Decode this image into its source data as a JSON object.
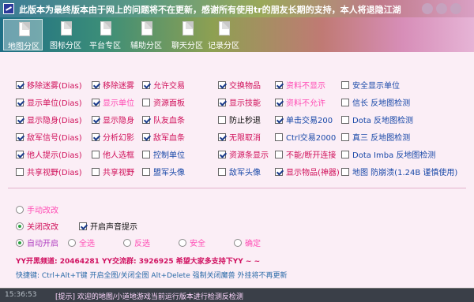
{
  "title": "此版本为最终版本由于网上的问题将不在更新，感谢所有使用tr的朋友长期的支持，本人将退隐江湖",
  "tabs": [
    {
      "label": "地图分区"
    },
    {
      "label": "图标分区"
    },
    {
      "label": "平台专区"
    },
    {
      "label": "辅助分区"
    },
    {
      "label": "聊天分区"
    },
    {
      "label": "记录分区"
    }
  ],
  "options": [
    {
      "label": "移除迷雾(Dias)",
      "checked": true
    },
    {
      "label": "移除迷雾",
      "checked": true
    },
    {
      "label": "允许交易",
      "checked": true
    },
    {
      "label": "交换物品",
      "checked": true
    },
    {
      "label": "资料不显示",
      "checked": true
    },
    {
      "label": "安全显示单位",
      "checked": false
    },
    {
      "label": "显示单位(Dias)",
      "checked": true
    },
    {
      "label": "显示单位",
      "checked": true
    },
    {
      "label": "资源面板",
      "checked": false
    },
    {
      "label": "显示技能",
      "checked": true
    },
    {
      "label": "资料不允许",
      "checked": true
    },
    {
      "label": "信长 反地图检测",
      "checked": false
    },
    {
      "label": "显示隐身(Dias)",
      "checked": true
    },
    {
      "label": "显示隐身",
      "checked": true
    },
    {
      "label": "队友血条",
      "checked": true
    },
    {
      "label": "防止秒退",
      "checked": false
    },
    {
      "label": "单击交易200",
      "checked": true
    },
    {
      "label": "Dota 反地图检测",
      "checked": false
    },
    {
      "label": "敌军信号(Dias)",
      "checked": true
    },
    {
      "label": "分析幻影",
      "checked": true
    },
    {
      "label": "敌军血条",
      "checked": true
    },
    {
      "label": "无限取消",
      "checked": true
    },
    {
      "label": "Ctrl交易2000",
      "checked": false
    },
    {
      "label": "真三 反地图检测",
      "checked": false
    },
    {
      "label": "他人提示(Dias)",
      "checked": true
    },
    {
      "label": "他人选框",
      "checked": false
    },
    {
      "label": "控制单位",
      "checked": false
    },
    {
      "label": "资源条显示",
      "checked": true
    },
    {
      "label": "不能/断开连接",
      "checked": false
    },
    {
      "label": "Dota Imba 反地图检测",
      "checked": false
    },
    {
      "label": "共享视野(Dias)",
      "checked": false
    },
    {
      "label": "共享视野",
      "checked": false
    },
    {
      "label": "盟军头像",
      "checked": false
    },
    {
      "label": "敌军头像",
      "checked": false
    },
    {
      "label": "显示物品(神器)",
      "checked": true
    },
    {
      "label": "地图 防崩溃(1.24B 谨慎使用)",
      "checked": false
    }
  ],
  "mode": [
    {
      "label": "手动改改",
      "checked": false
    },
    {
      "label": "关闭改改",
      "checked": true
    }
  ],
  "sound_label": "开启声音提示",
  "sound_checked": true,
  "auto_options": [
    {
      "label": "自动开启",
      "checked": true
    },
    {
      "label": "全选",
      "checked": false
    },
    {
      "label": "反选",
      "checked": false
    },
    {
      "label": "安全",
      "checked": false
    },
    {
      "label": "确定",
      "checked": false
    }
  ],
  "info": {
    "line1": "YY开黑频道: 20464281  YY交流群: 3926925  希望大家多支持下YY ~ ~",
    "line2": "快捷键: Ctrl+Alt+T键 开启全图/关闭全图   Alt+Delete 强制关闭魔兽 外挂将不再更新"
  },
  "status": {
    "time": "15:36:53",
    "message": "[提示] 欢迎的地图/小道地游戏当前运行版本进行检测反检测"
  }
}
